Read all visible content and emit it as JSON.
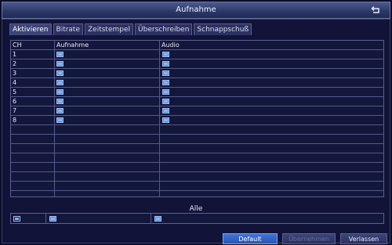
{
  "window": {
    "title": "Aufnahme"
  },
  "tabs": [
    {
      "label": "Aktivieren",
      "active": true
    },
    {
      "label": "Bitrate",
      "active": false
    },
    {
      "label": "Zeitstempel",
      "active": false
    },
    {
      "label": "Überschreiben",
      "active": false
    },
    {
      "label": "Schnappschuß",
      "active": false
    }
  ],
  "table": {
    "headers": {
      "ch": "CH",
      "recording": "Aufnahme",
      "audio": "Audio"
    },
    "rows": [
      {
        "ch": "1"
      },
      {
        "ch": "2"
      },
      {
        "ch": "3"
      },
      {
        "ch": "4"
      },
      {
        "ch": "5"
      },
      {
        "ch": "6"
      },
      {
        "ch": "7"
      },
      {
        "ch": "8"
      }
    ]
  },
  "all": {
    "label": "Alle"
  },
  "buttons": {
    "default": "Default",
    "apply": "Übernehmen",
    "exit": "Verlassen"
  },
  "icons": {
    "back": "back-arrow-icon"
  },
  "colors": {
    "accent": "#3f73d6",
    "checkbox": "#5f8fd8",
    "background": "#111438"
  }
}
